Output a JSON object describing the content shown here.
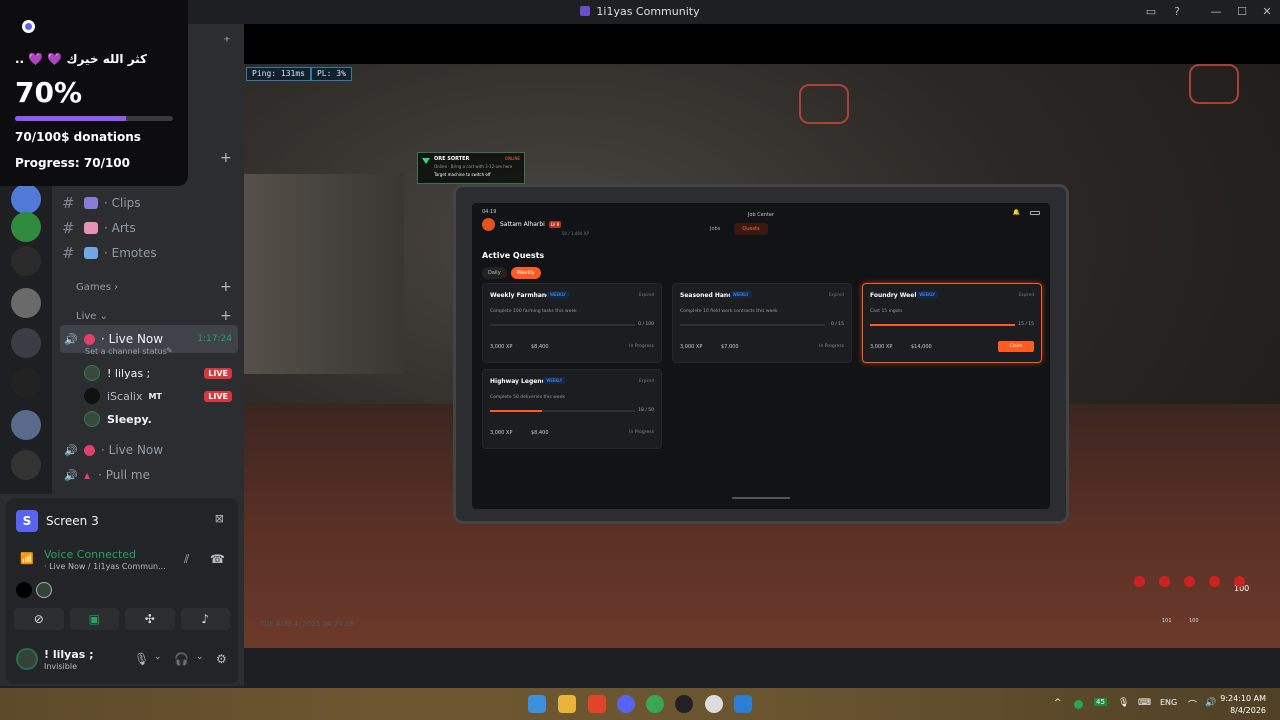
{
  "window": {
    "title": "1i1yas Community"
  },
  "donation": {
    "message": "كثر الله خيرك 💜 💜 ..",
    "percent_label": "70%",
    "progress_fraction": 0.7,
    "amount": "70/100$ donations",
    "progress_text": "Progress: 70/100"
  },
  "channels": {
    "text": [
      {
        "label": "· Clips"
      },
      {
        "label": "· Arts"
      },
      {
        "label": "· Emotes"
      }
    ],
    "categories": {
      "games": "Games",
      "live": "Live"
    },
    "voice_active": {
      "label": "· Live Now",
      "timer": "1:17:24",
      "status": "Set a channel status"
    },
    "participants": [
      {
        "name": "! lilyas ;",
        "badge": "LIVE"
      },
      {
        "name": "iScalix",
        "tag": "MT",
        "badge": "LIVE"
      },
      {
        "name": "Sleepy."
      }
    ],
    "voice_other": [
      {
        "label": "· Live Now"
      },
      {
        "label": "· Pull me"
      }
    ]
  },
  "panel": {
    "stream_badge": "S",
    "stream_name": "Screen 3",
    "voice_status": "Voice Connected",
    "voice_channel": "· Live Now / 1i1yas Commun...",
    "user": {
      "name": "! lilyas ;",
      "status": "Invisible"
    }
  },
  "game": {
    "ping": "Ping: 131ms",
    "pl": "PL: 3%",
    "ore": {
      "title": "ORE SORTER",
      "status": "ONLINE",
      "line1": "Online · Bring a cart with 3-12 ore here",
      "line2": "Target machine to switch off"
    },
    "tablet": {
      "time": "04:19",
      "header": "Job Center",
      "player": {
        "name": "Sattam Alharbi",
        "level": "LV 8",
        "xp": "50 / 1,464 XP"
      },
      "tabs": [
        "Jobs",
        "Quests"
      ],
      "section_title": "Active Quests",
      "filters": [
        "Daily",
        "Weekly"
      ],
      "quests": [
        {
          "title": "Weekly Farmhand",
          "tag": "WEEKLY",
          "expire": "Expired",
          "desc": "Complete 100 farming tasks this week",
          "progress": "0 / 100",
          "fraction": 0,
          "xp": "3,000 XP",
          "money": "$8,400",
          "state": "In Progress"
        },
        {
          "title": "Seasoned Hand",
          "tag": "WEEKLY",
          "expire": "Expired",
          "desc": "Complete 10 field work contracts this week",
          "progress": "0 / 15",
          "fraction": 0,
          "xp": "3,000 XP",
          "money": "$7,000",
          "state": "In Progress"
        },
        {
          "title": "Foundry Week",
          "tag": "WEEKLY",
          "expire": "Expired",
          "desc": "Cast 15 ingots",
          "progress": "15 / 15",
          "fraction": 1,
          "xp": "3,000 XP",
          "money": "$14,000",
          "state": "Claim"
        },
        {
          "title": "Highway Legend",
          "tag": "WEEKLY",
          "expire": "Expired",
          "desc": "Complete 50 deliveries this week",
          "progress": "18 / 50",
          "fraction": 0.36,
          "xp": "3,000 XP",
          "money": "$8,400",
          "state": "In Progress"
        }
      ]
    },
    "date_stamp": "TUE AUG 4, 2025 04:24:08",
    "hud_value": "100",
    "hud_labels": [
      "101",
      "100"
    ]
  },
  "taskbar": {
    "lang": "ENG",
    "time": "9:24:10 AM",
    "date": "8/4/2026",
    "badge": "45"
  },
  "colors": {
    "accent": "#ff5a1f",
    "discord_green": "#23a55a",
    "live_red": "#da373c",
    "donation_bar": "#8e5cf5"
  }
}
